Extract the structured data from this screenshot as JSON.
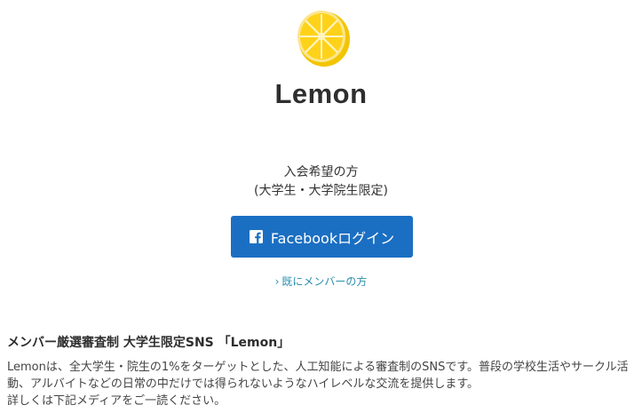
{
  "brand": {
    "logo_icon": "lemon-slice-icon",
    "title": "Lemon"
  },
  "join": {
    "line1": "入会希望の方",
    "line2": "(大学生・大学院生限定)"
  },
  "facebook_button": {
    "icon": "facebook-icon",
    "label": "Facebookログイン",
    "color": "#1b6fc2"
  },
  "member_link": {
    "chevron": "›",
    "label": "既にメンバーの方",
    "color": "#2a8fae"
  },
  "about": {
    "heading": "メンバー厳選審査制 大学生限定SNS 「Lemon」",
    "lines": [
      "Lemonは、全大学生・院生の1%をターゲットとした、人工知能による審査制のSNSです。普段の学校生活やサークル活",
      "動、アルバイトなどの日常の中だけでは得られないようなハイレベルな交流を提供します。",
      "詳しくは下記メディアをご一読ください。"
    ]
  }
}
